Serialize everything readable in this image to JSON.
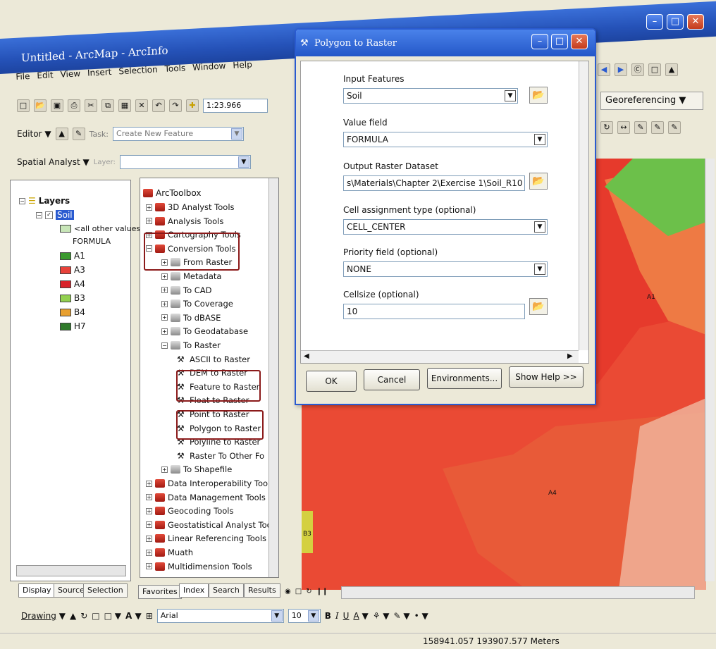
{
  "app": {
    "title": "Untitled - ArcMap - ArcInfo"
  },
  "menu": [
    "File",
    "Edit",
    "View",
    "Insert",
    "Selection",
    "Tools",
    "Window",
    "Help"
  ],
  "toolbar": {
    "scale": "1:23.966",
    "editor_label": "Editor",
    "task_label": "Task:",
    "task_value": "Create New Feature",
    "spatial_analyst_label": "Spatial Analyst",
    "layer_label": "Layer:",
    "georeferencing_label": "Georeferencing"
  },
  "toc": {
    "root": "Layers",
    "layer": "Soil",
    "other_values": "<all other values>",
    "field": "FORMULA",
    "classes": [
      {
        "label": "A1",
        "color": "#3a9a2e"
      },
      {
        "label": "A3",
        "color": "#e8423a"
      },
      {
        "label": "A4",
        "color": "#d8222a"
      },
      {
        "label": "B3",
        "color": "#92d050"
      },
      {
        "label": "B4",
        "color": "#e8a030"
      },
      {
        "label": "H7",
        "color": "#2f7a2a"
      }
    ],
    "tabs": [
      "Display",
      "Source",
      "Selection"
    ]
  },
  "toolbox": {
    "root": "ArcToolbox",
    "items": [
      "3D Analyst Tools",
      "Analysis Tools",
      "Cartography Tools",
      "Conversion Tools",
      "From Raster",
      "Metadata",
      "To CAD",
      "To Coverage",
      "To dBASE",
      "To Geodatabase",
      "To Raster",
      "ASCII to Raster",
      "DEM to Raster",
      "Feature to Raster",
      "Float to Raster",
      "Point to Raster",
      "Polygon to Raster",
      "Polyline to Raster",
      "Raster To Other Fo",
      "To Shapefile",
      "Data Interoperability Tools",
      "Data Management Tools",
      "Geocoding Tools",
      "Geostatistical Analyst Tool",
      "Linear Referencing Tools",
      "Muath",
      "Multidimension Tools"
    ],
    "tabs": [
      "Favorites",
      "Index",
      "Search",
      "Results"
    ]
  },
  "dialog": {
    "title": "Polygon to Raster",
    "input_features_label": "Input Features",
    "input_features_value": "Soil",
    "value_field_label": "Value field",
    "value_field_value": "FORMULA",
    "output_label": "Output Raster Dataset",
    "output_value": "s\\Materials\\Chapter 2\\Exercise 1\\Soil_R10",
    "cell_assignment_label": "Cell assignment type (optional)",
    "cell_assignment_value": "CELL_CENTER",
    "priority_label": "Priority field (optional)",
    "priority_value": "NONE",
    "cellsize_label": "Cellsize (optional)",
    "cellsize_value": "10",
    "ok": "OK",
    "cancel": "Cancel",
    "environments": "Environments...",
    "show_help": "Show Help >>"
  },
  "map": {
    "labels": [
      "A1",
      "A4",
      "B3"
    ]
  },
  "drawing": {
    "drawing_label": "Drawing",
    "font": "Arial",
    "font_size": "10",
    "bold": "B",
    "italic": "I",
    "underline": "U",
    "font_color": "A"
  },
  "status": {
    "coords": "158941.057  193907.577 Meters"
  }
}
